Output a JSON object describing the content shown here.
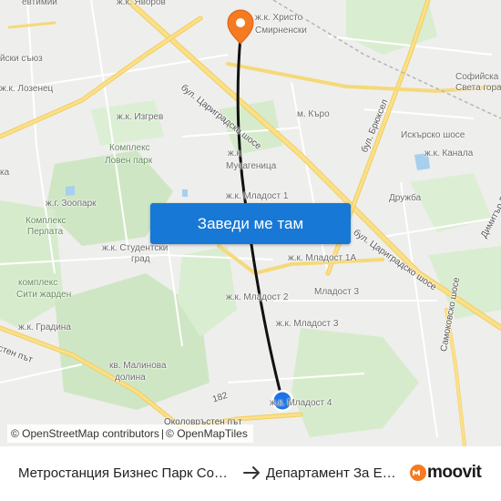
{
  "map": {
    "labels": [
      {
        "text": "евтимий",
        "cls": ""
      },
      {
        "text": "ж.к. Яворов",
        "cls": ""
      },
      {
        "text": "ж.к. Христо",
        "cls": ""
      },
      {
        "text": "Смирненски",
        "cls": ""
      },
      {
        "text": "йски съюз",
        "cls": ""
      },
      {
        "text": "ж.к. Лозенец",
        "cls": ""
      },
      {
        "text": "Софийска",
        "cls": ""
      },
      {
        "text": "Света гора",
        "cls": ""
      },
      {
        "text": "бул. Цариградско шосе",
        "cls": "road"
      },
      {
        "text": "ж.к. Изгрев",
        "cls": ""
      },
      {
        "text": "м. Къро",
        "cls": ""
      },
      {
        "text": "Искърско шосе",
        "cls": ""
      },
      {
        "text": "Комплекс",
        "cls": "green"
      },
      {
        "text": "Ловен парк",
        "cls": "green"
      },
      {
        "text": "ж.к.",
        "cls": ""
      },
      {
        "text": "Мусагеница",
        "cls": ""
      },
      {
        "text": "бул. Брюксел",
        "cls": "road"
      },
      {
        "text": "ж.к. Канала",
        "cls": ""
      },
      {
        "text": "ка",
        "cls": ""
      },
      {
        "text": "ж.г. Зоопарк",
        "cls": ""
      },
      {
        "text": "ж.к. Младост 1",
        "cls": ""
      },
      {
        "text": "Дружба",
        "cls": ""
      },
      {
        "text": "Комплекс",
        "cls": "green"
      },
      {
        "text": "Перлата",
        "cls": "green"
      },
      {
        "text": "ж.к. Студентски",
        "cls": ""
      },
      {
        "text": "град",
        "cls": ""
      },
      {
        "text": "ж.к. Младост 1А",
        "cls": ""
      },
      {
        "text": "бул. Цариградско шосе",
        "cls": "road"
      },
      {
        "text": "Димитър Пешев",
        "cls": "road"
      },
      {
        "text": "комплекс",
        "cls": "green"
      },
      {
        "text": "Сити жарден",
        "cls": "green"
      },
      {
        "text": "Младост 3",
        "cls": ""
      },
      {
        "text": "ж.к. Младост 2",
        "cls": ""
      },
      {
        "text": "ж.к. Младост 3",
        "cls": ""
      },
      {
        "text": "ж.к. Градина",
        "cls": ""
      },
      {
        "text": "стен път",
        "cls": "road"
      },
      {
        "text": "кв. Малинова",
        "cls": ""
      },
      {
        "text": "долина",
        "cls": ""
      },
      {
        "text": "Самоковско шосе",
        "cls": "road"
      },
      {
        "text": "182",
        "cls": "road"
      },
      {
        "text": "ж.к. Младост 4",
        "cls": ""
      },
      {
        "text": "Околовръстен път",
        "cls": "road"
      }
    ],
    "colors": {
      "route": "#111111",
      "destination_pin": "#f47b20",
      "origin_dot": "#1a73e8",
      "park": "#cfe6c4",
      "major_road": "#fbe08a",
      "water": "#a7cfee"
    }
  },
  "cta": {
    "label": "Заведи ме там"
  },
  "attribution": {
    "osm_text": "© OpenStreetMap contributors",
    "sep": "|",
    "omt_text": "© OpenMapTiles"
  },
  "footer": {
    "from": "Метростанция Бизнес Парк София",
    "to": "Департамент За Езиково Обучение",
    "brand": "moovit"
  }
}
